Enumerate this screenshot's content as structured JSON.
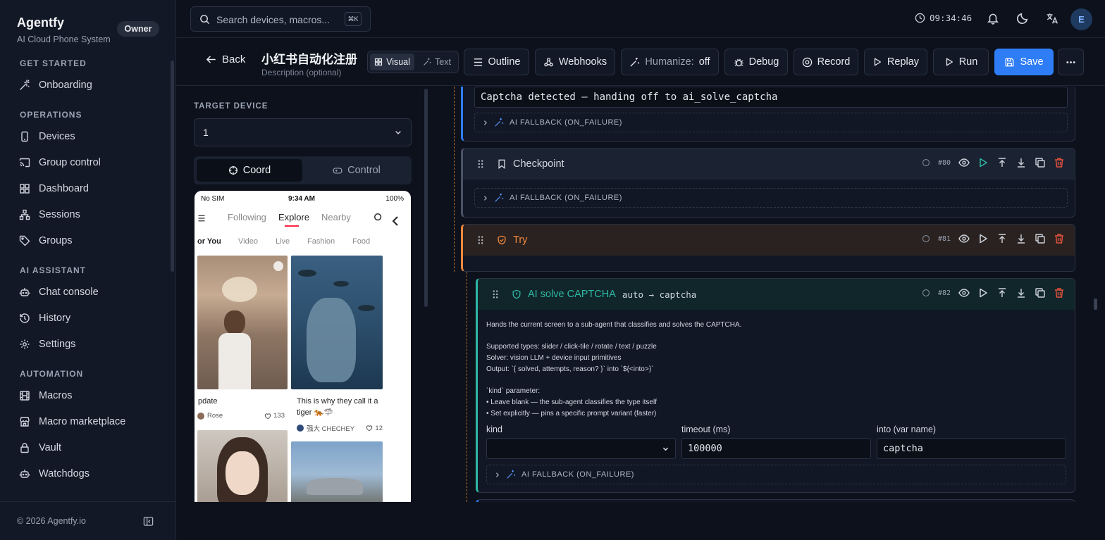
{
  "app": {
    "name": "Agentfy",
    "subtitle": "AI Cloud Phone System",
    "role_badge": "Owner",
    "copyright": "© 2026 Agentfy.io"
  },
  "sidebar": {
    "sections": [
      {
        "title": "GET STARTED",
        "items": [
          {
            "label": "Onboarding",
            "icon": "wand-icon"
          }
        ]
      },
      {
        "title": "OPERATIONS",
        "items": [
          {
            "label": "Devices",
            "icon": "phone-icon"
          },
          {
            "label": "Group control",
            "icon": "cast-icon"
          },
          {
            "label": "Dashboard",
            "icon": "grid-icon"
          },
          {
            "label": "Sessions",
            "icon": "network-icon"
          },
          {
            "label": "Groups",
            "icon": "tag-icon"
          }
        ]
      },
      {
        "title": "AI ASSISTANT",
        "items": [
          {
            "label": "Chat console",
            "icon": "bot-icon"
          },
          {
            "label": "History",
            "icon": "history-icon"
          },
          {
            "label": "Settings",
            "icon": "gear-icon"
          }
        ]
      },
      {
        "title": "AUTOMATION",
        "items": [
          {
            "label": "Macros",
            "icon": "film-icon"
          },
          {
            "label": "Macro marketplace",
            "icon": "store-icon"
          },
          {
            "label": "Vault",
            "icon": "lock-icon"
          },
          {
            "label": "Watchdogs",
            "icon": "bot-icon"
          }
        ]
      }
    ]
  },
  "topbar": {
    "search_placeholder": "Search devices, macros...",
    "shortcut": "⌘K",
    "time": "09:34:46",
    "avatar_initial": "E"
  },
  "editor": {
    "back_label": "Back",
    "macro_title": "小红书自动化注册",
    "description_placeholder": "Description (optional)",
    "view_modes": {
      "visual": "Visual",
      "text": "Text"
    },
    "toolbar": {
      "outline": "Outline",
      "webhooks": "Webhooks",
      "humanize_label": "Humanize:",
      "humanize_value": "off",
      "debug": "Debug",
      "record": "Record",
      "replay": "Replay",
      "run": "Run",
      "save": "Save"
    }
  },
  "device_panel": {
    "target_label": "TARGET DEVICE",
    "target_value": "1",
    "mode_coord": "Coord",
    "mode_control": "Control",
    "phone": {
      "carrier": "No SIM",
      "time": "9:34 AM",
      "battery": "100%",
      "tabs": [
        "Following",
        "Explore",
        "Nearby"
      ],
      "categories": [
        "or You",
        "Video",
        "Live",
        "Fashion",
        "Food"
      ],
      "cards": [
        {
          "title": "pdate",
          "author": "Rose",
          "likes": "133"
        },
        {
          "title": "This is why they call it a tiger 🐅🦈",
          "author": "强大 CHECHEY",
          "likes": "12"
        }
      ]
    }
  },
  "flow": {
    "log_message": "Captcha detected — handing off to ai_solve_captcha",
    "fallback_label": "AI FALLBACK (ON_FAILURE)",
    "steps": [
      {
        "name": "Checkpoint",
        "num": "#80",
        "icon": "bookmark-icon",
        "color": "#d5d9e2"
      },
      {
        "name": "Try",
        "num": "#81",
        "icon": "shield-icon",
        "color": "#f0883e"
      },
      {
        "name": "AI solve CAPTCHA",
        "num": "#82",
        "icon": "shield-icon",
        "color": "#2fb7a6",
        "summary": "auto → captcha"
      }
    ],
    "captcha": {
      "description": [
        "Hands the current screen to a sub-agent that classifies and solves the CAPTCHA.",
        "",
        "Supported types: slider / click-tile / rotate / text / puzzle",
        "Solver: vision LLM + device input primitives",
        "Output: `{ solved, attempts, reason? }` into `${<into>}`",
        "",
        "`kind` parameter:",
        "• Leave blank — the sub-agent classifies the type itself",
        "• Set explicitly — pins a specific prompt variant (faster)"
      ],
      "kind_label": "kind",
      "kind_value": "",
      "timeout_label": "timeout (ms)",
      "timeout_value": "100000",
      "into_label": "into (var name)",
      "into_value": "captcha"
    }
  },
  "colors": {
    "accent": "#2f7df6",
    "try": "#f0883e",
    "captcha": "#2fb7a6",
    "delete": "#e5533d",
    "play": "#2fb7a6"
  }
}
